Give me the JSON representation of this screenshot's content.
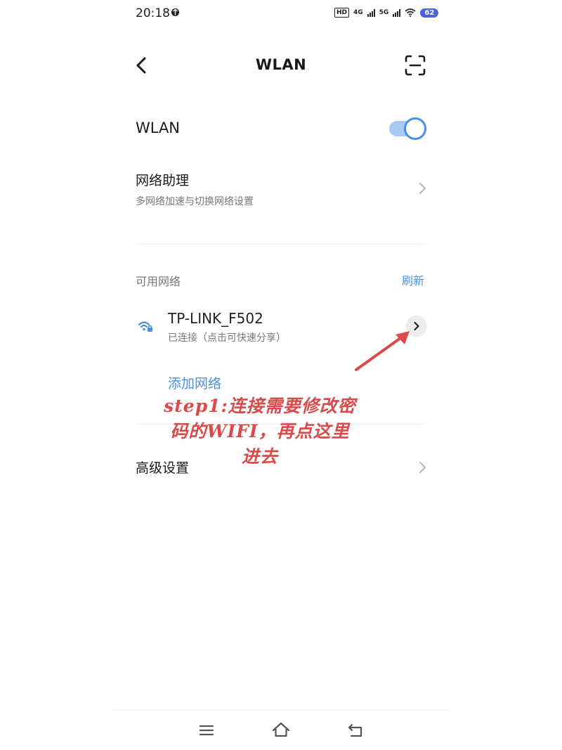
{
  "status_bar": {
    "time": "20:18",
    "network_tags": [
      "HD",
      "4G",
      "5G"
    ],
    "battery": "62",
    "battery_color": "#4c62d6"
  },
  "header": {
    "title": "WLAN",
    "back_icon": "chevron-left-icon",
    "scan_icon": "scan-icon"
  },
  "wlan": {
    "label": "WLAN",
    "enabled": true,
    "toggle_color": "#4a90e2"
  },
  "assistant": {
    "title": "网络助理",
    "subtitle": "多网络加速与切换网络设置"
  },
  "available_networks": {
    "label": "可用网络",
    "refresh_label": "刷新",
    "networks": [
      {
        "name": "TP-LINK_F502",
        "status": "已连接（点击可快速分享）",
        "connected": true
      }
    ]
  },
  "add_network_label": "添加网络",
  "advanced_label": "高级设置",
  "annotation": {
    "line1": "step1:连接需要修改密",
    "line2": "码的WIFI，再点这里",
    "line3": "进去",
    "color": "#d94a4a"
  },
  "nav": {
    "menu_icon": "menu-icon",
    "home_icon": "home-icon",
    "back_icon": "back-icon"
  }
}
